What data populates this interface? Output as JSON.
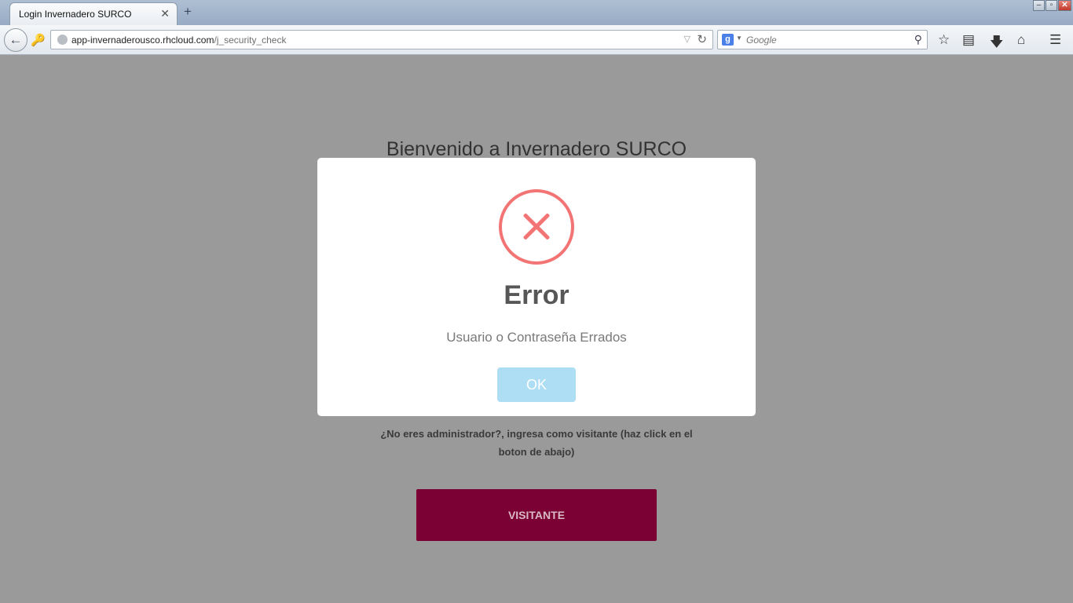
{
  "browser": {
    "tab_title": "Login Invernadero SURCO",
    "tab_close": "✕",
    "new_tab": "+",
    "url_host": "app-invernaderousco.rhcloud.com",
    "url_path": "/j_security_check",
    "search_engine_letter": "g",
    "search_placeholder": "Google"
  },
  "page": {
    "heading": "Bienvenido a Invernadero SURCO",
    "visitor_note": "¿No eres administrador?, ingresa como visitante (haz click en el boton de abajo)",
    "visitor_button": "VISITANTE"
  },
  "modal": {
    "title": "Error",
    "message": "Usuario o Contraseña Errados",
    "ok_label": "OK",
    "icon": "error-x-icon",
    "accent_color": "#f27474",
    "button_color": "#aedef4"
  },
  "colors": {
    "overlay": "#9a9a9a",
    "visitor_button": "#7b0033"
  }
}
